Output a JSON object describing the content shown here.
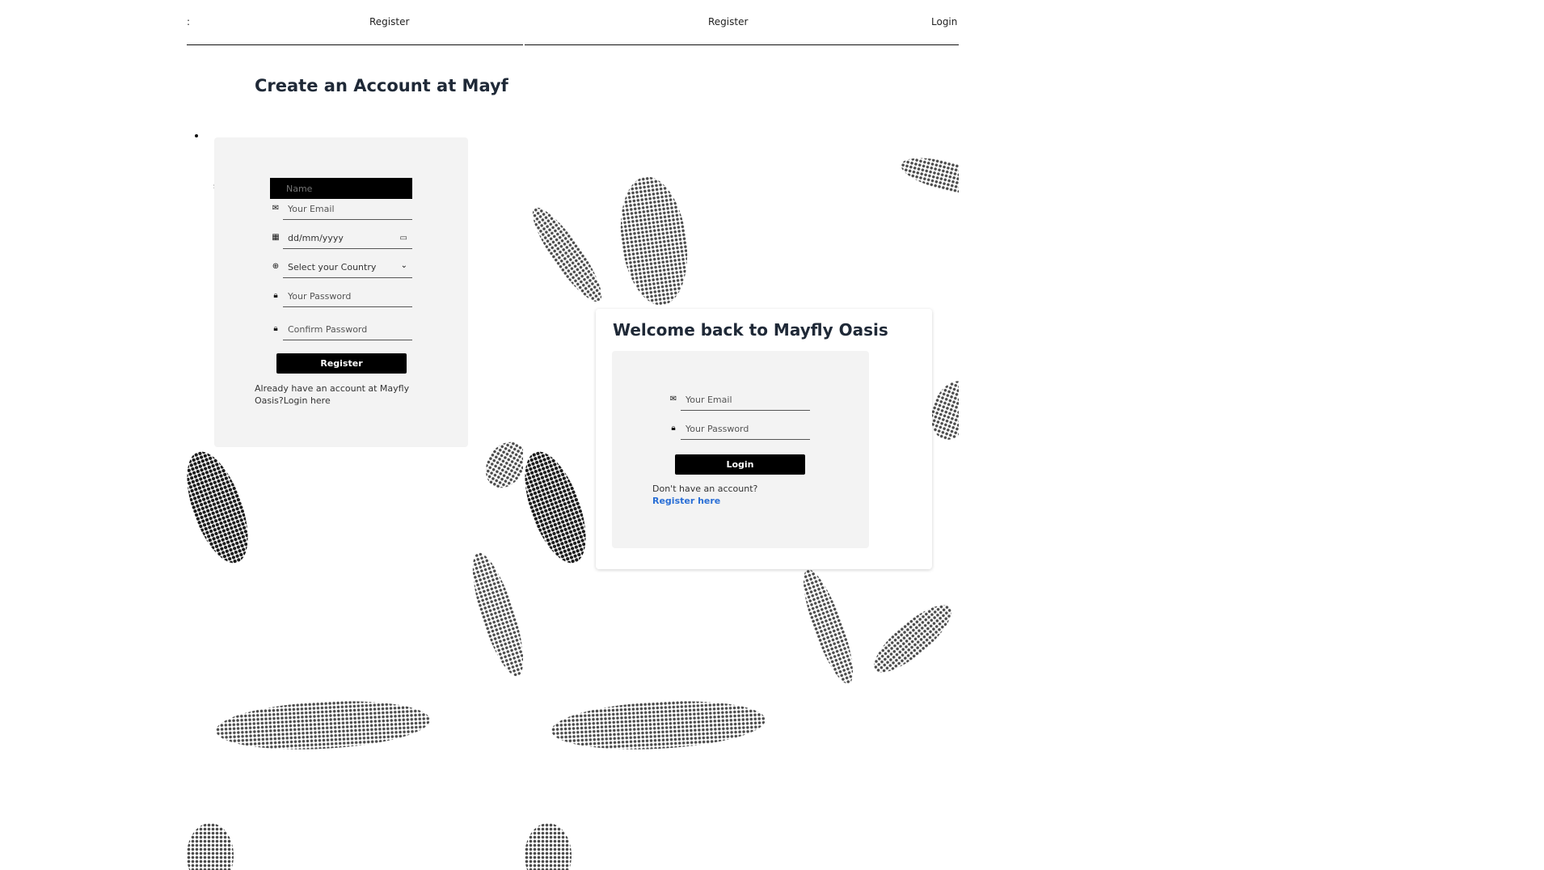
{
  "left_pane": {
    "nav": {
      "left_fragment": ":",
      "register": "Register"
    },
    "title": "Create an Account at Mayf",
    "form": {
      "name_placeholder": "Name",
      "email_placeholder": "Your Email",
      "dob_placeholder": "dd/mm/yyyy",
      "country_selected": "Select your Country",
      "password_placeholder": "Your Password",
      "confirm_placeholder": "Confirm Password",
      "submit_label": "Register",
      "footer_text": "Already have an account at Mayfly Oasis?",
      "footer_link": "Login here"
    }
  },
  "right_pane": {
    "nav": {
      "register": "Register",
      "login": "Login"
    },
    "title": "Welcome back to Mayfly Oasis",
    "form": {
      "email_placeholder": "Your Email",
      "password_placeholder": "Your Password",
      "submit_label": "Login",
      "footer_text": "Don't have an account?",
      "footer_link": "Register here"
    }
  },
  "icons": [
    "envelope-icon",
    "calendar-icon",
    "globe-icon",
    "lock-icon",
    "chevron-down-icon"
  ],
  "colors": {
    "button_bg": "#000000",
    "card_bg": "#f3f3f3",
    "link_blue": "#2a6fd6",
    "title": "#1f2937"
  }
}
